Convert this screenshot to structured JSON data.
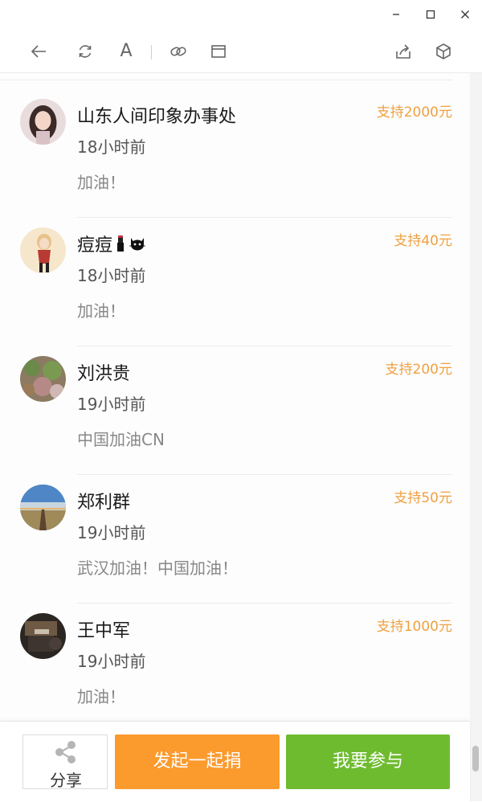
{
  "window": {
    "controls": [
      "minimize-icon",
      "maximize-icon",
      "close-icon"
    ]
  },
  "toolbar": {
    "icons": [
      "back-arrow-icon",
      "refresh-icon",
      "font-size-icon",
      "link-icon",
      "window-icon",
      "share-out-icon",
      "cube-icon"
    ],
    "font_glyph": "A"
  },
  "donations": [
    {
      "name": "山东人间印象办事处",
      "time": "18小时前",
      "message": "加油！",
      "amount": "支持2000元"
    },
    {
      "name": "痘痘",
      "name_emoji": [
        "lipstick-icon",
        "cat-face-icon"
      ],
      "time": "18小时前",
      "message": "加油！",
      "amount": "支持40元"
    },
    {
      "name": "刘洪贵",
      "time": "19小时前",
      "message": "中国加油CN",
      "amount": "支持200元"
    },
    {
      "name": "郑利群",
      "time": "19小时前",
      "message": "武汉加油！中国加油！",
      "amount": "支持50元"
    },
    {
      "name": "王中军",
      "time": "19小时前",
      "message": "加油！",
      "amount": "支持1000元"
    }
  ],
  "bottom": {
    "share_label": "分享",
    "start_label": "发起一起捐",
    "join_label": "我要参与"
  },
  "colors": {
    "amount": "#f0a040",
    "start_button": "#fb9a2d",
    "join_button": "#6fbb30"
  }
}
